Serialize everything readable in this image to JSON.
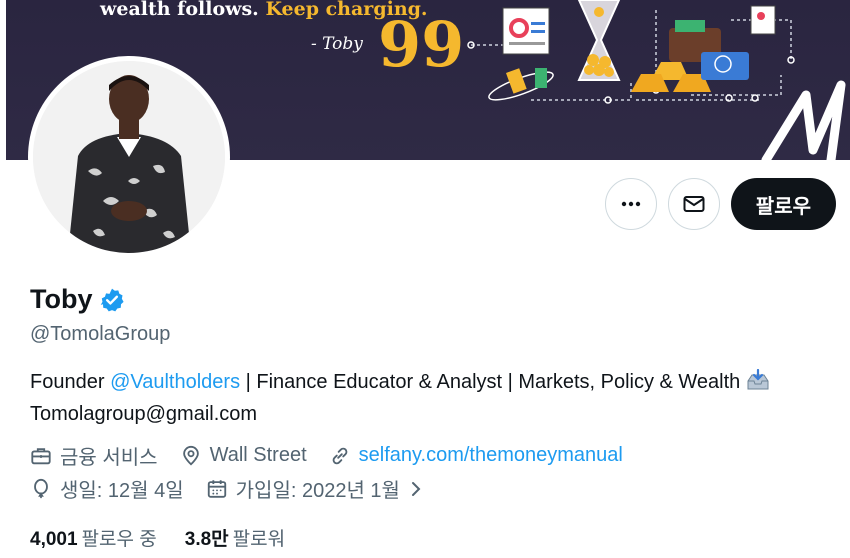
{
  "banner": {
    "tagline_part1": "wealth follows.",
    "tagline_part2": "Keep charging.",
    "signature": "- Toby",
    "quote_mark": "99"
  },
  "profile": {
    "name": "Toby",
    "handle": "@TomolaGroup",
    "verified_icon": "verified-badge-icon"
  },
  "actions": {
    "more_icon": "more-icon",
    "message_icon": "envelope-icon",
    "follow_label": "팔로우"
  },
  "bio": {
    "prefix": "Founder ",
    "mention": "@Vaultholders",
    "rest": " | Finance Educator & Analyst | Markets, Policy & Wealth",
    "email": "Tomolagroup@gmail.com"
  },
  "meta": {
    "category": "금융 서비스",
    "location": "Wall Street",
    "website": "selfany.com/themoneymanual",
    "birthday": "생일: 12월 4일",
    "joined": "가입일: 2022년 1월"
  },
  "stats": {
    "following_count": "4,001",
    "following_label": "팔로우 중",
    "followers_count": "3.8만",
    "followers_label": "팔로워"
  },
  "colors": {
    "accent": "#1d9bf0",
    "banner_bg": "#2f2a45",
    "banner_gold": "#f5b82e",
    "follow_bg": "#0f1419"
  }
}
